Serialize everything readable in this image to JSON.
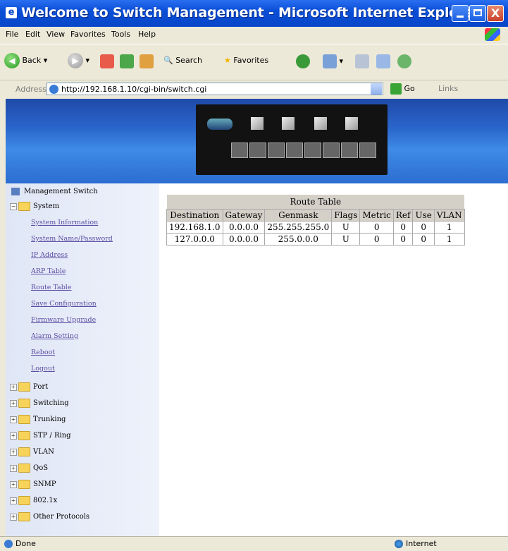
{
  "window": {
    "title": "Welcome to Switch Management - Microsoft Internet Explorer",
    "close_glyph": "X"
  },
  "menu": [
    "File",
    "Edit",
    "View",
    "Favorites",
    "Tools",
    "Help"
  ],
  "toolbar": {
    "back": "Back",
    "search": "Search",
    "favorites": "Favorites"
  },
  "address": {
    "label": "Address",
    "url": "http://192.168.1.10/cgi-bin/switch.cgi",
    "go": "Go",
    "links": "Links"
  },
  "sidebar": {
    "root": "Management Switch",
    "system": "System",
    "system_items": [
      "System Information",
      "System Name/Password",
      "IP Address",
      "ARP Table",
      "Route Table",
      "Save Configuration",
      "Firmware Upgrade",
      "Alarm Setting",
      "Reboot",
      "Logout"
    ],
    "folders": [
      "Port",
      "Switching",
      "Trunking",
      "STP / Ring",
      "VLAN",
      "QoS",
      "SNMP",
      "802.1x",
      "Other Protocols"
    ]
  },
  "route_table": {
    "title": "Route Table",
    "headers": [
      "Destination",
      "Gateway",
      "Genmask",
      "Flags",
      "Metric",
      "Ref",
      "Use",
      "VLAN"
    ],
    "rows": [
      [
        "192.168.1.0",
        "0.0.0.0",
        "255.255.255.0",
        "U",
        "0",
        "0",
        "0",
        "1"
      ],
      [
        "127.0.0.0",
        "0.0.0.0",
        "255.0.0.0",
        "U",
        "0",
        "0",
        "0",
        "1"
      ]
    ]
  },
  "status": {
    "text": "Done",
    "zone": "Internet"
  },
  "colors": {
    "titlebar": "#0846c8",
    "link": "#5b4ea3",
    "banner": "#2a66cc"
  }
}
